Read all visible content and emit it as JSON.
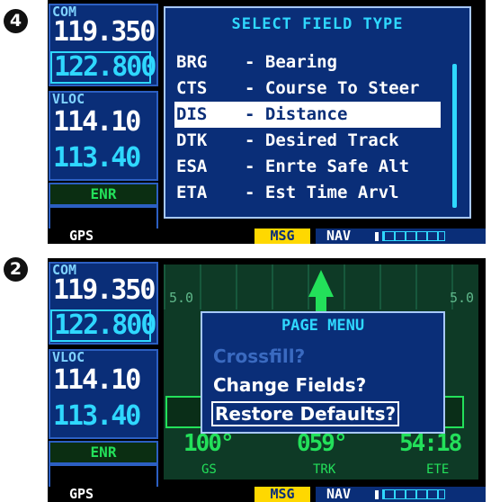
{
  "screens": [
    {
      "step": "4",
      "com_label": "COM",
      "com_active": "119.350",
      "com_standby": "122.800",
      "vloc_label": "VLOC",
      "vloc_active": "114.10",
      "vloc_standby": "113.40",
      "mode": "ENR",
      "status": {
        "gps": "GPS",
        "msg": "MSG",
        "nav": "NAV"
      },
      "window": {
        "title": "SELECT FIELD TYPE",
        "items": [
          {
            "abbr": "BRG",
            "desc": "- Bearing"
          },
          {
            "abbr": "CTS",
            "desc": "- Course To Steer"
          },
          {
            "abbr": "DIS",
            "desc": "- Distance"
          },
          {
            "abbr": "DTK",
            "desc": "- Desired Track"
          },
          {
            "abbr": "ESA",
            "desc": "- Enrte Safe Alt"
          },
          {
            "abbr": "ETA",
            "desc": "- Est Time Arvl"
          }
        ],
        "selected_index": 2
      }
    },
    {
      "step": "2",
      "com_label": "COM",
      "com_active": "119.350",
      "com_standby": "122.800",
      "vloc_label": "VLOC",
      "vloc_active": "114.10",
      "vloc_standby": "113.40",
      "mode": "ENR",
      "status": {
        "gps": "GPS",
        "msg": "MSG",
        "nav": "NAV"
      },
      "map": {
        "scale_left": "5.0",
        "scale_right": "5.0",
        "data_fields": [
          {
            "value": "100°",
            "label": "GS"
          },
          {
            "value": "059°",
            "label": "TRK"
          },
          {
            "value": "54:18",
            "label": "ETE"
          }
        ]
      },
      "menu": {
        "title": "PAGE MENU",
        "items": [
          {
            "label": "Crossfill?",
            "state": "disabled"
          },
          {
            "label": "Change Fields?",
            "state": "normal"
          },
          {
            "label": "Restore Defaults?",
            "state": "selected"
          }
        ]
      }
    }
  ],
  "colors": {
    "panel_blue": "#0a2e78",
    "cyan": "#2fd8ff",
    "green": "#23e05a",
    "yellow": "#ffd800"
  },
  "icons": {
    "map_track_arrow": "up-arrow-icon",
    "cdi_bar": "cdi-icon"
  }
}
